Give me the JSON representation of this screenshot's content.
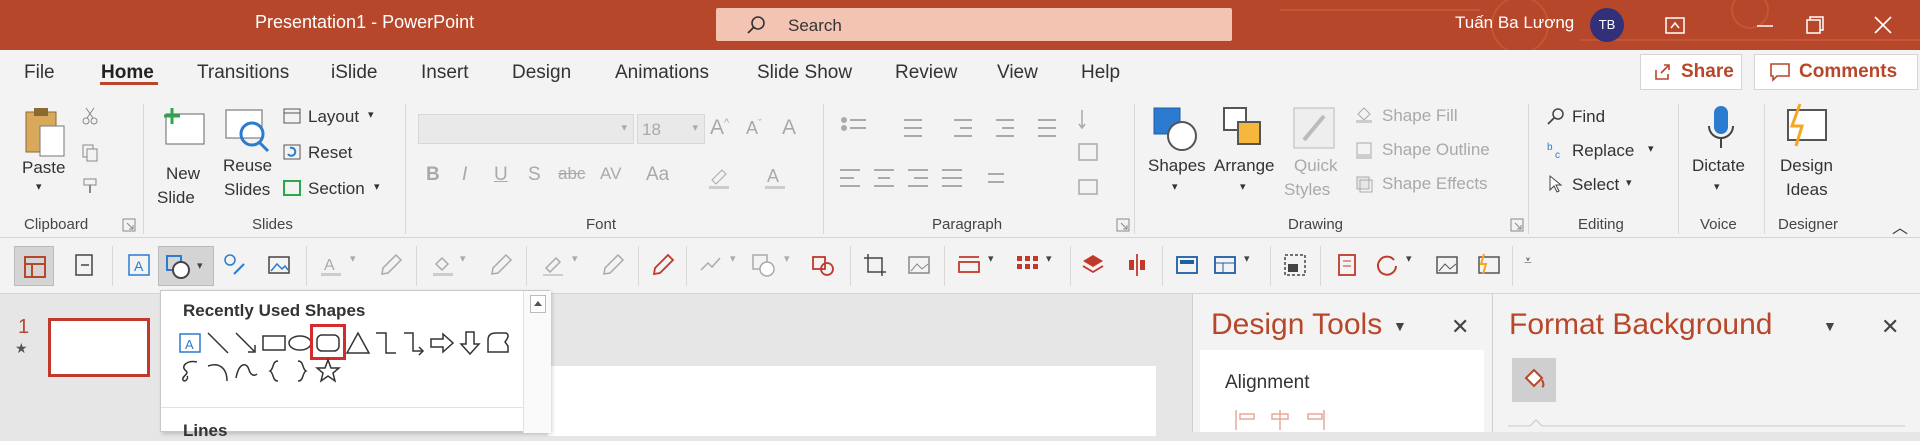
{
  "window": {
    "title": "Presentation1  -  PowerPoint",
    "search_placeholder": "Search",
    "user_name": "Tuấn Ba Lương",
    "user_initials": "TB",
    "brand_color": "#b7472a"
  },
  "tabs": [
    "File",
    "Home",
    "Transitions",
    "iSlide",
    "Insert",
    "Design",
    "Animations",
    "Slide Show",
    "Review",
    "View",
    "Help"
  ],
  "active_tab": "Home",
  "share_label": "Share",
  "comments_label": "Comments",
  "ribbon": {
    "clipboard": {
      "label": "Clipboard",
      "paste": "Paste"
    },
    "slides": {
      "label": "Slides",
      "new_slide_1": "New",
      "new_slide_2": "Slide",
      "reuse_1": "Reuse",
      "reuse_2": "Slides",
      "layout": "Layout",
      "reset": "Reset",
      "section": "Section"
    },
    "font": {
      "label": "Font",
      "size": "18"
    },
    "paragraph": {
      "label": "Paragraph"
    },
    "drawing": {
      "label": "Drawing",
      "shapes": "Shapes",
      "arrange": "Arrange",
      "quick_styles_1": "Quick",
      "quick_styles_2": "Styles",
      "shape_fill": "Shape Fill",
      "shape_outline": "Shape Outline",
      "shape_effects": "Shape Effects"
    },
    "editing": {
      "label": "Editing",
      "find": "Find",
      "replace": "Replace",
      "select": "Select"
    },
    "voice": {
      "label": "Voice",
      "dictate": "Dictate"
    },
    "designer": {
      "label": "Designer",
      "ideas_1": "Design",
      "ideas_2": "Ideas"
    }
  },
  "thumbnail": {
    "number": "1",
    "star": "★"
  },
  "gallery": {
    "heading_recent": "Recently Used Shapes",
    "heading_lines": "Lines",
    "shape_icons_row1": [
      "text-box-icon",
      "line-icon",
      "arrow-line-icon",
      "rectangle-icon",
      "oval-icon",
      "rounded-rectangle-icon",
      "triangle-icon",
      "elbow-connector-icon",
      "elbow-arrow-connector-icon",
      "right-arrow-icon",
      "down-arrow-icon",
      "snip-shape-icon"
    ],
    "shape_icons_row2": [
      "freeform-icon",
      "arc-icon",
      "curve-icon",
      "left-brace-icon",
      "right-brace-icon",
      "star-icon"
    ],
    "highlight_color": "#d42c2c"
  },
  "design_tools": {
    "title": "Design Tools",
    "alignment": "Alignment"
  },
  "format_background": {
    "title": "Format Background"
  }
}
